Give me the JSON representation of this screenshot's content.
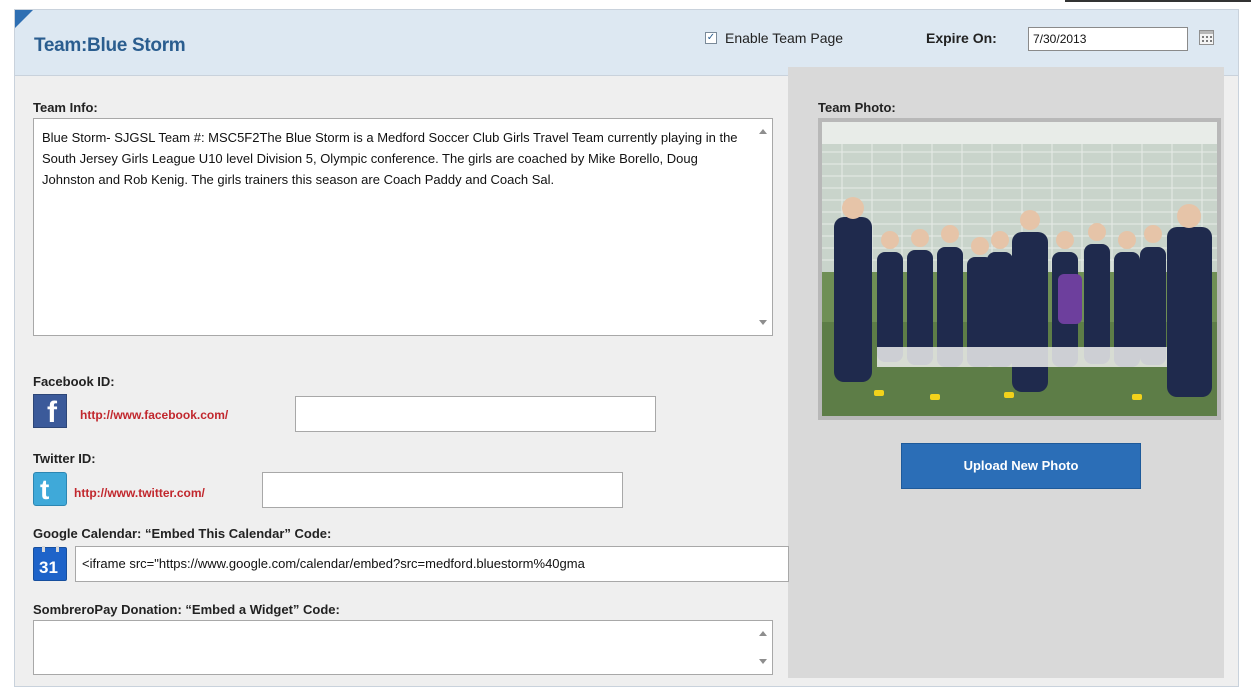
{
  "header": {
    "team_title": "Team:Blue Storm",
    "enable_label": "Enable Team Page",
    "enable_checked": true,
    "expire_label": "Expire On:",
    "expire_value": "7/30/2013"
  },
  "team_info": {
    "label": "Team Info:",
    "text": "Blue Storm- SJGSL Team #: MSC5F2The Blue Storm is a Medford Soccer Club Girls Travel Team currently playing in the South Jersey Girls League U10 level Division 5, Olympic conference. The girls are coached by Mike Borello, Doug Johnston and Rob Kenig. The girls trainers this season are Coach Paddy and Coach Sal."
  },
  "facebook": {
    "label": "Facebook ID:",
    "url_prefix": "http://www.facebook.com/",
    "value": ""
  },
  "twitter": {
    "label": "Twitter ID:",
    "url_prefix": "http://www.twitter.com/",
    "value": ""
  },
  "google_calendar": {
    "label": "Google Calendar: “Embed This Calendar” Code:",
    "icon_text": "31",
    "value": "<iframe src=\"https://www.google.com/calendar/embed?src=medford.bluestorm%40gma"
  },
  "donation": {
    "label": "SombreroPay Donation: “Embed a Widget” Code:",
    "value": ""
  },
  "photo": {
    "label": "Team Photo:",
    "upload_button": "Upload New Photo"
  },
  "icons": {
    "facebook": "facebook-icon",
    "twitter": "twitter-icon",
    "calendar": "calendar-icon",
    "google_calendar": "google-calendar-icon"
  },
  "colors": {
    "accent": "#2b6eb7",
    "title": "#2a5d8f",
    "url": "#c1272d",
    "header_bg": "#dde8f2"
  }
}
